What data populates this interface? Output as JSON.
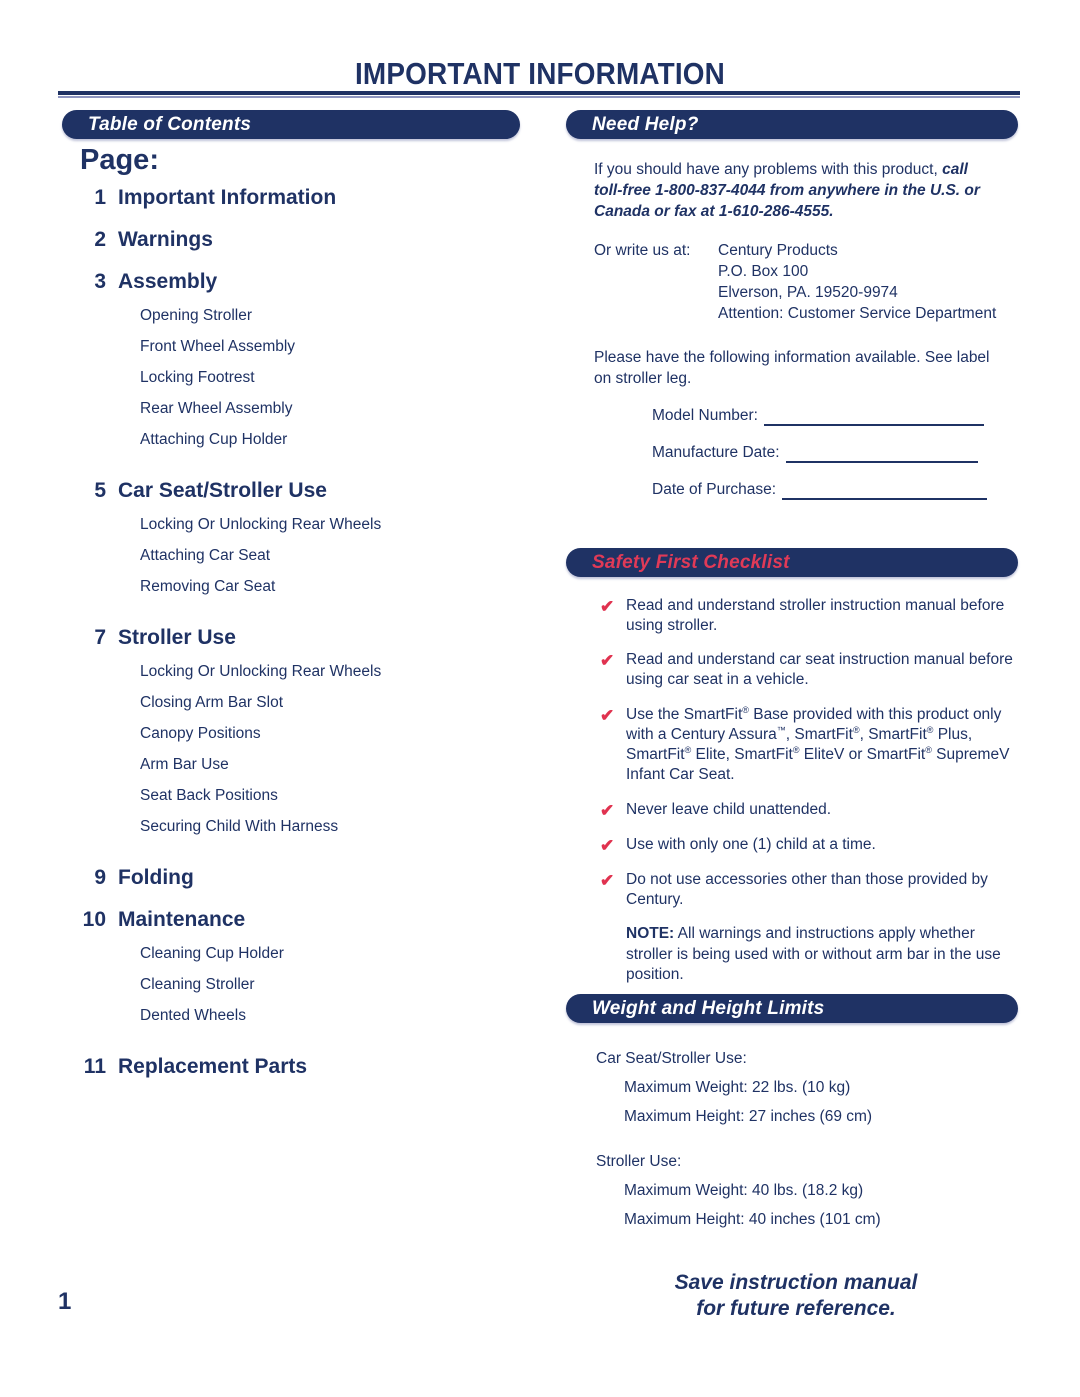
{
  "document": {
    "title": "IMPORTANT INFORMATION",
    "page_number": "1"
  },
  "left": {
    "toc_header": "Table of Contents",
    "page_label": "Page:",
    "entries": [
      {
        "num": "1",
        "title": "Important Information",
        "subs": []
      },
      {
        "num": "2",
        "title": "Warnings",
        "subs": []
      },
      {
        "num": "3",
        "title": "Assembly",
        "subs": [
          "Opening Stroller",
          "Front Wheel Assembly",
          "Locking Footrest",
          "Rear Wheel Assembly",
          "Attaching Cup Holder"
        ]
      },
      {
        "num": "5",
        "title": "Car Seat/Stroller Use",
        "subs": [
          "Locking Or Unlocking Rear Wheels",
          "Attaching Car Seat",
          "Removing Car Seat"
        ]
      },
      {
        "num": "7",
        "title": "Stroller Use",
        "subs": [
          "Locking Or Unlocking Rear Wheels",
          "Closing Arm Bar Slot",
          "Canopy Positions",
          "Arm Bar Use",
          "Seat Back Positions",
          "Securing Child With Harness"
        ]
      },
      {
        "num": "9",
        "title": "Folding",
        "subs": []
      },
      {
        "num": "10",
        "title": "Maintenance",
        "subs": [
          "Cleaning Cup Holder",
          "Cleaning Stroller",
          "Dented Wheels"
        ]
      },
      {
        "num": "11",
        "title": "Replacement Parts",
        "subs": []
      }
    ]
  },
  "need_help": {
    "header": "Need Help?",
    "intro_plain": "If you should have any problems with this product, ",
    "intro_emph_1": "call",
    "intro_emph_2": "toll-free 1-800-837-4044 from anywhere in the U.S. or",
    "intro_emph_3": "Canada or fax at 1-610-286-4555.",
    "write_label": "Or write us at:",
    "address": [
      "Century Products",
      "P.O. Box 100",
      "Elverson, PA. 19520-9974",
      "Attention:  Customer Service Department"
    ],
    "available_line_1": "Please have the following information available.  See label",
    "available_line_2": "on stroller leg.",
    "fields": [
      "Model Number:",
      "Manufacture Date:",
      "Date of Purchase:"
    ]
  },
  "safety": {
    "header": "Safety First Checklist",
    "check_glyph": "✔",
    "items": [
      "Read and understand stroller instruction manual before using stroller.",
      "Read and understand car seat instruction manual before using car seat in a vehicle.",
      "Never leave child unattended.",
      "Use with only one (1) child at a time.",
      "Do not use accessories other than those provided by Century."
    ],
    "smartfit_item": {
      "line1_a": "Use the SmartFit",
      "line1_sup": "®",
      "line1_b": " Base provided with this product",
      "line2_a": "only with a Century Assura",
      "line2_sup1": "™",
      "line2_b": ", SmartFit",
      "line2_sup2": "®",
      "line2_c": ", SmartFit",
      "line2_sup3": "®",
      "line2_d": " Plus,",
      "line3_a": "SmartFit",
      "line3_sup1": "®",
      "line3_b": " Elite, SmartFit",
      "line3_sup2": "®",
      "line3_c": " EliteV or SmartFit",
      "line3_sup3": "®",
      "line3_d": " SupremeV",
      "line4": "Infant Car Seat."
    },
    "note_label": "NOTE:",
    "note_text": "  All warnings and instructions apply whether stroller is being used with or without arm bar in the use position."
  },
  "limits": {
    "header": "Weight and Height Limits",
    "groups": [
      {
        "name": "Car Seat/Stroller Use:",
        "rows": [
          "Maximum Weight:  22 lbs. (10 kg)",
          "Maximum Height:  27 inches (69 cm)"
        ]
      },
      {
        "name": "Stroller Use:",
        "rows": [
          "Maximum Weight:  40 lbs. (18.2 kg)",
          "Maximum Height:  40 inches (101 cm)"
        ]
      }
    ]
  },
  "footer": {
    "save_line_1": "Save instruction manual",
    "save_line_2": "for future reference."
  },
  "colors": {
    "navy": "#1f3264",
    "red": "#e0324f",
    "rule_light": "#8e95c0"
  }
}
